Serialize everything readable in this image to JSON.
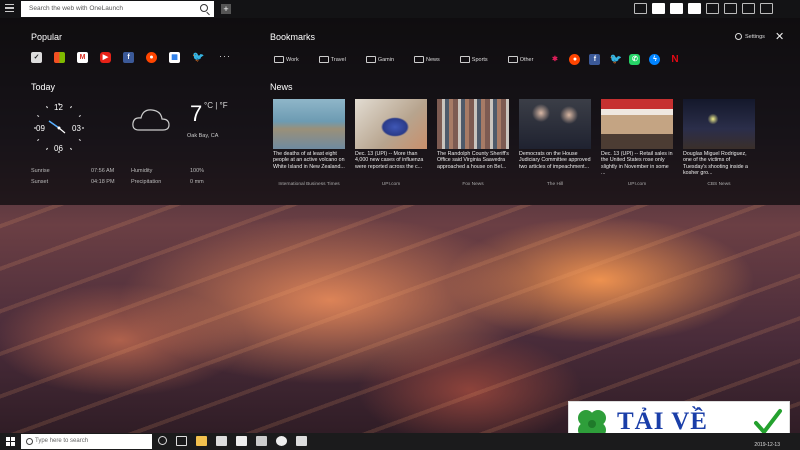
{
  "search": {
    "placeholder": "Search the web with OneLaunch"
  },
  "sections": {
    "popular": "Popular",
    "bookmarks": "Bookmarks",
    "today": "Today",
    "news": "News"
  },
  "settings_label": "Settings",
  "popular_icons": [
    "custom-app-icon",
    "office-icon",
    "gmail-icon",
    "youtube-icon",
    "facebook-icon",
    "reddit-icon",
    "calendar-icon",
    "twitter-icon"
  ],
  "more_label": "···",
  "bookmark_folders": [
    "Work",
    "Travel",
    "Gamin",
    "News",
    "Sports",
    "Other"
  ],
  "bookmark_icons": [
    "slack-icon",
    "reddit-icon",
    "facebook-icon",
    "twitter-icon",
    "whatsapp-icon",
    "messenger-icon",
    "netflix-icon"
  ],
  "clock": {
    "n12": "12",
    "n3": "03",
    "n6": "06",
    "n9": "09"
  },
  "weather": {
    "temp": "7",
    "unit": "°C | °F",
    "location": "Oak Bay, CA"
  },
  "sun": {
    "sunrise_label": "Sunrise",
    "sunrise": "07:56 AM",
    "sunset_label": "Sunset",
    "sunset": "04:18 PM"
  },
  "conditions": {
    "humidity_label": "Humidity",
    "humidity": "100%",
    "precip_label": "Precipitation",
    "precip": "0 mm"
  },
  "news": [
    {
      "caption": "The deaths of at least eight people at an active volcano on White Island in New Zealand...",
      "source": "International Business Times"
    },
    {
      "caption": "Dec. 13 (UPI) -- More than 4,000 new cases of influenza were reported across the c...",
      "source": "UPI.com"
    },
    {
      "caption": "The Randolph County Sheriff's Office said Virginia Saavedra approached a house on Bel...",
      "source": "Fox News"
    },
    {
      "caption": "Democrats on the House Judiciary Committee approved two articles of impeachment...",
      "source": "The Hill"
    },
    {
      "caption": "Dec. 13 (UPI) -- Retail sales in the United States rose only slightly in November in some ...",
      "source": "UPI.com"
    },
    {
      "caption": "Douglas Miguel Rodriguez, one of the victims of Tuesday's shooting inside a kosher gro...",
      "source": "CBS News"
    }
  ],
  "taskbar": {
    "search_placeholder": "Type here to search",
    "date": "2019-12-13"
  },
  "watermark": {
    "text": "TẢI VỀ"
  }
}
